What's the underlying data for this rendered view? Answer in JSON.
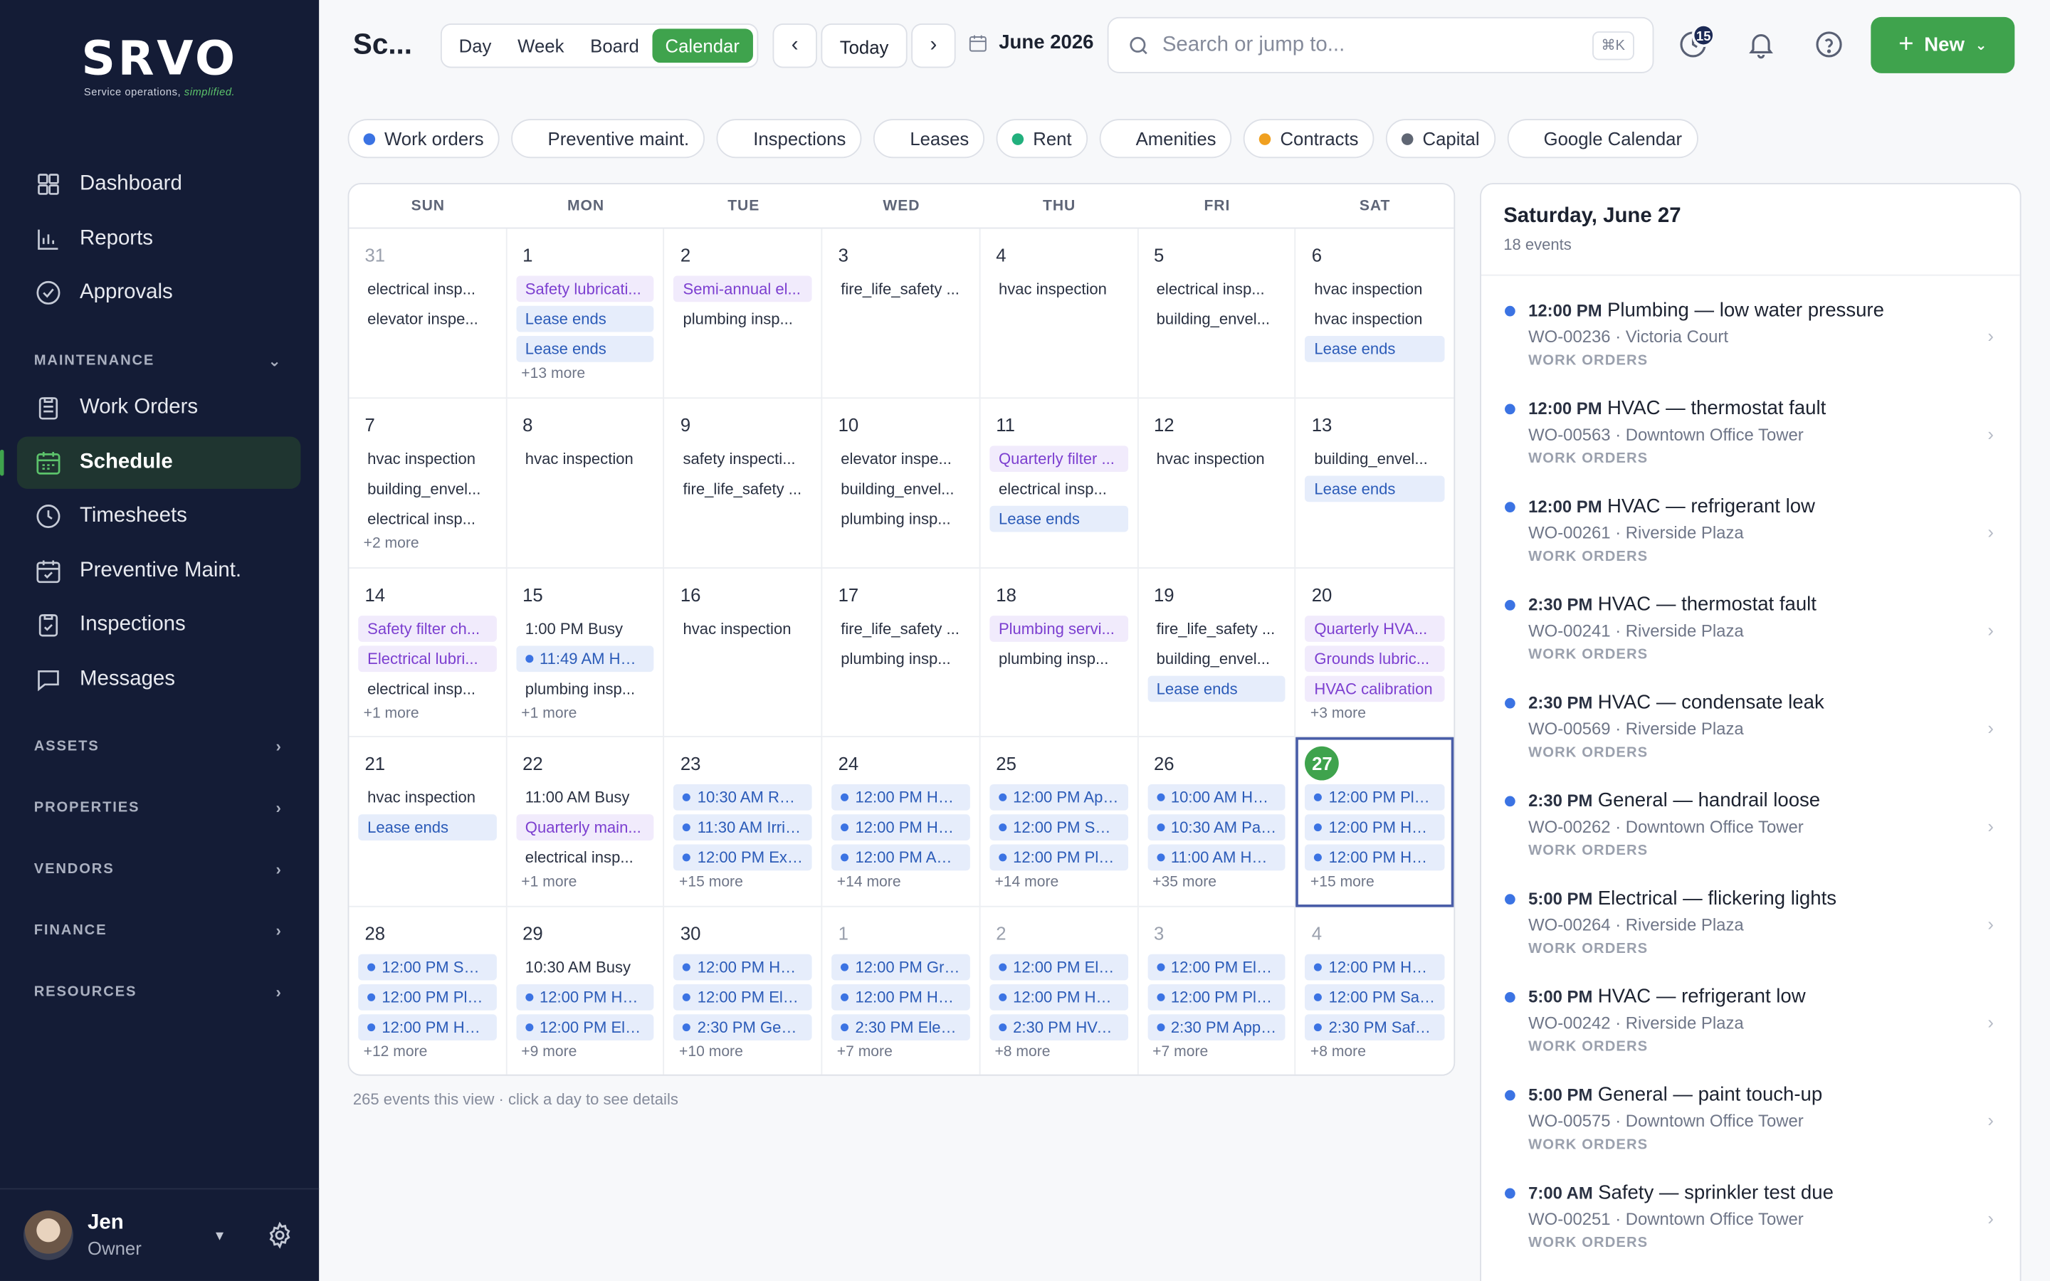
{
  "app": {
    "logo": "SRVO",
    "tagline_prefix": "Service operations, ",
    "tagline_em": "simplified."
  },
  "sidebar": {
    "top_items": [
      {
        "label": "Dashboard",
        "icon": "grid-icon"
      },
      {
        "label": "Reports",
        "icon": "bar-chart-icon"
      },
      {
        "label": "Approvals",
        "icon": "check-circle-icon"
      }
    ],
    "maintenance_label": "MAINTENANCE",
    "maintenance_items": [
      {
        "label": "Work Orders",
        "icon": "clipboard-icon"
      },
      {
        "label": "Schedule",
        "icon": "calendar-icon",
        "active": true
      },
      {
        "label": "Timesheets",
        "icon": "clock-icon"
      },
      {
        "label": "Preventive Maint.",
        "icon": "calendar-check-icon"
      },
      {
        "label": "Inspections",
        "icon": "clipboard-check-icon"
      },
      {
        "label": "Messages",
        "icon": "message-icon"
      }
    ],
    "sections": [
      "ASSETS",
      "PROPERTIES",
      "VENDORS",
      "FINANCE",
      "RESOURCES"
    ],
    "user": {
      "name": "Jen",
      "role": "Owner"
    }
  },
  "topbar": {
    "title": "Sc...",
    "views": [
      "Day",
      "Week",
      "Board",
      "Calendar"
    ],
    "active_view": "Calendar",
    "today": "Today",
    "month": "June 2026",
    "search_placeholder": "Search or jump to...",
    "search_shortcut": "⌘K",
    "badge_count": "15",
    "new_label": "New"
  },
  "filters": [
    {
      "label": "Work orders",
      "color": "#3b73e3"
    },
    {
      "label": "Preventive maint.",
      "color": ""
    },
    {
      "label": "Inspections",
      "color": ""
    },
    {
      "label": "Leases",
      "color": ""
    },
    {
      "label": "Rent",
      "color": "#22b07d"
    },
    {
      "label": "Amenities",
      "color": ""
    },
    {
      "label": "Contracts",
      "color": "#f0a020"
    },
    {
      "label": "Capital",
      "color": "#5f6673"
    },
    {
      "label": "Google Calendar",
      "color": ""
    }
  ],
  "calendar": {
    "weekdays": [
      "SUN",
      "MON",
      "TUE",
      "WED",
      "THU",
      "FRI",
      "SAT"
    ],
    "days": [
      {
        "d": "31",
        "other": true,
        "ev": [
          {
            "t": "electrical insp..."
          },
          {
            "t": "elevator inspe..."
          }
        ]
      },
      {
        "d": "1",
        "ev": [
          {
            "t": "Safety lubricati...",
            "k": "pur"
          },
          {
            "t": "Lease ends",
            "k": "blu"
          },
          {
            "t": "Lease ends",
            "k": "blu"
          }
        ],
        "more": "+13 more"
      },
      {
        "d": "2",
        "ev": [
          {
            "t": "Semi-annual el...",
            "k": "pur"
          },
          {
            "t": "plumbing insp..."
          }
        ]
      },
      {
        "d": "3",
        "ev": [
          {
            "t": "fire_life_safety ..."
          }
        ]
      },
      {
        "d": "4",
        "ev": [
          {
            "t": "hvac inspection"
          }
        ]
      },
      {
        "d": "5",
        "ev": [
          {
            "t": "electrical insp..."
          },
          {
            "t": "building_envel..."
          }
        ]
      },
      {
        "d": "6",
        "ev": [
          {
            "t": "hvac inspection"
          },
          {
            "t": "hvac inspection"
          },
          {
            "t": "Lease ends",
            "k": "blu"
          }
        ]
      },
      {
        "d": "7",
        "ev": [
          {
            "t": "hvac inspection"
          },
          {
            "t": "building_envel..."
          },
          {
            "t": "electrical insp..."
          }
        ],
        "more": "+2 more"
      },
      {
        "d": "8",
        "ev": [
          {
            "t": "hvac inspection"
          }
        ]
      },
      {
        "d": "9",
        "ev": [
          {
            "t": "safety inspecti..."
          },
          {
            "t": "fire_life_safety ..."
          }
        ]
      },
      {
        "d": "10",
        "ev": [
          {
            "t": "elevator inspe..."
          },
          {
            "t": "building_envel..."
          },
          {
            "t": "plumbing insp..."
          }
        ]
      },
      {
        "d": "11",
        "ev": [
          {
            "t": "Quarterly filter ...",
            "k": "pur"
          },
          {
            "t": "electrical insp..."
          },
          {
            "t": "Lease ends",
            "k": "blu"
          }
        ]
      },
      {
        "d": "12",
        "ev": [
          {
            "t": "hvac inspection"
          }
        ]
      },
      {
        "d": "13",
        "ev": [
          {
            "t": "building_envel..."
          },
          {
            "t": "Lease ends",
            "k": "blu"
          }
        ]
      },
      {
        "d": "14",
        "ev": [
          {
            "t": "Safety filter ch...",
            "k": "pur"
          },
          {
            "t": "Electrical lubri...",
            "k": "pur"
          },
          {
            "t": "electrical insp..."
          }
        ],
        "more": "+1 more"
      },
      {
        "d": "15",
        "ev": [
          {
            "t": "1:00 PM Busy"
          },
          {
            "t": "11:49 AM HVA...",
            "k": "blu dot"
          },
          {
            "t": "plumbing insp..."
          }
        ],
        "more": "+1 more"
      },
      {
        "d": "16",
        "ev": [
          {
            "t": "hvac inspection"
          }
        ]
      },
      {
        "d": "17",
        "ev": [
          {
            "t": "fire_life_safety ..."
          },
          {
            "t": "plumbing insp..."
          }
        ]
      },
      {
        "d": "18",
        "ev": [
          {
            "t": "Plumbing servi...",
            "k": "pur"
          },
          {
            "t": "plumbing insp..."
          }
        ]
      },
      {
        "d": "19",
        "ev": [
          {
            "t": "fire_life_safety ..."
          },
          {
            "t": "building_envel..."
          },
          {
            "t": "Lease ends",
            "k": "blu"
          }
        ]
      },
      {
        "d": "20",
        "ev": [
          {
            "t": "Quarterly HVA...",
            "k": "pur"
          },
          {
            "t": "Grounds lubric...",
            "k": "pur"
          },
          {
            "t": "HVAC calibration",
            "k": "pur"
          }
        ],
        "more": "+3 more"
      },
      {
        "d": "21",
        "ev": [
          {
            "t": "hvac inspection"
          },
          {
            "t": "Lease ends",
            "k": "blu"
          }
        ]
      },
      {
        "d": "22",
        "ev": [
          {
            "t": "11:00 AM Busy"
          },
          {
            "t": "Quarterly main...",
            "k": "pur"
          },
          {
            "t": "electrical insp..."
          }
        ],
        "more": "+1 more"
      },
      {
        "d": "23",
        "ev": [
          {
            "t": "10:30 AM Roof...",
            "k": "blu dot"
          },
          {
            "t": "11:30 AM Irriga...",
            "k": "blu dot"
          },
          {
            "t": "12:00 PM Exha...",
            "k": "blu dot"
          }
        ],
        "more": "+15 more"
      },
      {
        "d": "24",
        "ev": [
          {
            "t": "12:00 PM HVA...",
            "k": "blu dot"
          },
          {
            "t": "12:00 PM HVA...",
            "k": "blu dot"
          },
          {
            "t": "12:00 PM Appli...",
            "k": "blu dot"
          }
        ],
        "more": "+14 more"
      },
      {
        "d": "25",
        "ev": [
          {
            "t": "12:00 PM Appli...",
            "k": "blu dot"
          },
          {
            "t": "12:00 PM Safe...",
            "k": "blu dot"
          },
          {
            "t": "12:00 PM Plum...",
            "k": "blu dot"
          }
        ],
        "more": "+14 more"
      },
      {
        "d": "26",
        "ev": [
          {
            "t": "10:00 AM HVA...",
            "k": "blu dot"
          },
          {
            "t": "10:30 AM Parki...",
            "k": "blu dot"
          },
          {
            "t": "11:00 AM HVA...",
            "k": "blu dot"
          }
        ],
        "more": "+35 more"
      },
      {
        "d": "27",
        "today": true,
        "sel": true,
        "ev": [
          {
            "t": "12:00 PM Plum...",
            "k": "blu dot"
          },
          {
            "t": "12:00 PM HVA...",
            "k": "blu dot"
          },
          {
            "t": "12:00 PM HVA...",
            "k": "blu dot"
          }
        ],
        "more": "+15 more"
      },
      {
        "d": "28",
        "ev": [
          {
            "t": "12:00 PM Safe...",
            "k": "blu dot"
          },
          {
            "t": "12:00 PM Plum...",
            "k": "blu dot"
          },
          {
            "t": "12:00 PM HVA...",
            "k": "blu dot"
          }
        ],
        "more": "+12 more"
      },
      {
        "d": "29",
        "ev": [
          {
            "t": "10:30 AM Busy"
          },
          {
            "t": "12:00 PM HVA...",
            "k": "blu dot"
          },
          {
            "t": "12:00 PM Elect...",
            "k": "blu dot"
          }
        ],
        "more": "+9 more"
      },
      {
        "d": "30",
        "ev": [
          {
            "t": "12:00 PM HVA...",
            "k": "blu dot"
          },
          {
            "t": "12:00 PM Elect...",
            "k": "blu dot"
          },
          {
            "t": "2:30 PM Gene...",
            "k": "blu dot"
          }
        ],
        "more": "+10 more"
      },
      {
        "d": "1",
        "other": true,
        "ev": [
          {
            "t": "12:00 PM Grou...",
            "k": "blu dot"
          },
          {
            "t": "12:00 PM HVA...",
            "k": "blu dot"
          },
          {
            "t": "2:30 PM Electr...",
            "k": "blu dot"
          }
        ],
        "more": "+7 more"
      },
      {
        "d": "2",
        "other": true,
        "ev": [
          {
            "t": "12:00 PM Elect...",
            "k": "blu dot"
          },
          {
            "t": "12:00 PM HVA...",
            "k": "blu dot"
          },
          {
            "t": "2:30 PM HVAC...",
            "k": "blu dot"
          }
        ],
        "more": "+8 more"
      },
      {
        "d": "3",
        "other": true,
        "ev": [
          {
            "t": "12:00 PM Elect...",
            "k": "blu dot"
          },
          {
            "t": "12:00 PM Plum...",
            "k": "blu dot"
          },
          {
            "t": "2:30 PM Appli...",
            "k": "blu dot"
          }
        ],
        "more": "+7 more"
      },
      {
        "d": "4",
        "other": true,
        "ev": [
          {
            "t": "12:00 PM HVA...",
            "k": "blu dot"
          },
          {
            "t": "12:00 PM Safe...",
            "k": "blu dot"
          },
          {
            "t": "2:30 PM Safet...",
            "k": "blu dot"
          }
        ],
        "more": "+8 more"
      }
    ],
    "footer": "265 events this view · click a day to see details"
  },
  "panel": {
    "title": "Saturday, June 27",
    "subtitle": "18 events",
    "events": [
      {
        "time": "12:00 PM",
        "title": "Plumbing — low water pressure",
        "meta": "WO-00236 · Victoria Court",
        "cat": "WORK ORDERS"
      },
      {
        "time": "12:00 PM",
        "title": "HVAC — thermostat fault",
        "meta": "WO-00563 · Downtown Office Tower",
        "cat": "WORK ORDERS"
      },
      {
        "time": "12:00 PM",
        "title": "HVAC — refrigerant low",
        "meta": "WO-00261 · Riverside Plaza",
        "cat": "WORK ORDERS"
      },
      {
        "time": "2:30 PM",
        "title": "HVAC — thermostat fault",
        "meta": "WO-00241 · Riverside Plaza",
        "cat": "WORK ORDERS"
      },
      {
        "time": "2:30 PM",
        "title": "HVAC — condensate leak",
        "meta": "WO-00569 · Riverside Plaza",
        "cat": "WORK ORDERS"
      },
      {
        "time": "2:30 PM",
        "title": "General — handrail loose",
        "meta": "WO-00262 · Downtown Office Tower",
        "cat": "WORK ORDERS"
      },
      {
        "time": "5:00 PM",
        "title": "Electrical — flickering lights",
        "meta": "WO-00264 · Riverside Plaza",
        "cat": "WORK ORDERS"
      },
      {
        "time": "5:00 PM",
        "title": "HVAC — refrigerant low",
        "meta": "WO-00242 · Riverside Plaza",
        "cat": "WORK ORDERS"
      },
      {
        "time": "5:00 PM",
        "title": "General — paint touch-up",
        "meta": "WO-00575 · Downtown Office Tower",
        "cat": "WORK ORDERS"
      },
      {
        "time": "7:00 AM",
        "title": "Safety — sprinkler test due",
        "meta": "WO-00251 · Downtown Office Tower",
        "cat": "WORK ORDERS"
      }
    ]
  }
}
